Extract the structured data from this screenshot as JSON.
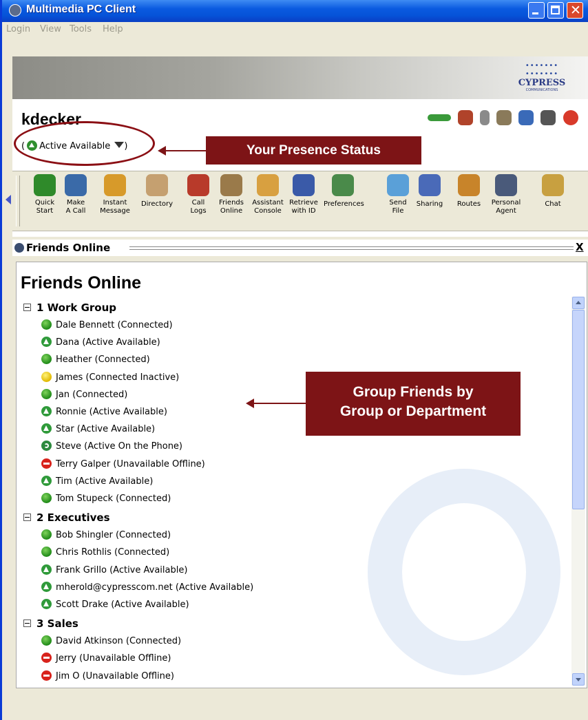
{
  "window": {
    "title": "Multimedia PC Client"
  },
  "menu": [
    "Login",
    "View",
    "Tools",
    "Help"
  ],
  "banner": {
    "logo_text": "CYPRESS",
    "logo_sub": "COMMUNICATIONS"
  },
  "user": {
    "name": "kdecker",
    "presence_prefix": "(",
    "presence": "Active Available",
    "presence_suffix": ")"
  },
  "annotations": {
    "presence_callout": "Your Presence Status",
    "group_callout_line1": "Group Friends by",
    "group_callout_line2": "Group or Department",
    "callout_color": "#7d1416"
  },
  "toolbar": [
    {
      "label": "Quick\nStart",
      "icon": "flag-icon",
      "color": "#2f8a2a"
    },
    {
      "label": "Make\nA Call",
      "icon": "phone-icon",
      "color": "#3a6aa8"
    },
    {
      "label": "Instant\nMessage",
      "icon": "person-icon",
      "color": "#d79a2a"
    },
    {
      "label": "Directory",
      "icon": "directory-icon",
      "color": "#c5a070"
    },
    {
      "label": "Call\nLogs",
      "icon": "call-logs-icon",
      "color": "#b83a2a"
    },
    {
      "label": "Friends\nOnline",
      "icon": "friends-icon",
      "color": "#9a7a4a"
    },
    {
      "label": "Assistant\nConsole",
      "icon": "console-icon",
      "color": "#d8a040"
    },
    {
      "label": "Retrieve\nwith ID",
      "icon": "retrieve-icon",
      "color": "#3a5aa8"
    },
    {
      "label": "Preferences",
      "icon": "preferences-icon",
      "color": "#4a8a4a"
    },
    {
      "label": "Send\nFile",
      "icon": "send-file-icon",
      "color": "#5aa0d8"
    },
    {
      "label": "Sharing",
      "icon": "sharing-icon",
      "color": "#4a6ab8"
    },
    {
      "label": "Routes",
      "icon": "routes-icon",
      "color": "#c8842a"
    },
    {
      "label": "Personal\nAgent",
      "icon": "agent-icon",
      "color": "#4a5a7a"
    },
    {
      "label": "Chat",
      "icon": "chat-icon",
      "color": "#c8a040"
    }
  ],
  "panel": {
    "header": "Friends Online",
    "close": "X",
    "title": "Friends Online"
  },
  "groups": [
    {
      "name": "1 Work Group",
      "friends": [
        {
          "text": "Dale Bennett (Connected)",
          "status": "connected"
        },
        {
          "text": "Dana (Active Available)",
          "status": "available"
        },
        {
          "text": "Heather (Connected)",
          "status": "connected"
        },
        {
          "text": "James (Connected Inactive)",
          "status": "inactive"
        },
        {
          "text": "Jan (Connected)",
          "status": "connected"
        },
        {
          "text": "Ronnie (Active Available)",
          "status": "available"
        },
        {
          "text": "Star (Active Available)",
          "status": "available"
        },
        {
          "text": "Steve (Active On the Phone)",
          "status": "phone"
        },
        {
          "text": "Terry Galper (Unavailable Offline)",
          "status": "offline"
        },
        {
          "text": "Tim (Active Available)",
          "status": "available"
        },
        {
          "text": "Tom Stupeck (Connected)",
          "status": "connected"
        }
      ]
    },
    {
      "name": "2 Executives",
      "friends": [
        {
          "text": "Bob Shingler (Connected)",
          "status": "connected"
        },
        {
          "text": "Chris Rothlis (Connected)",
          "status": "connected"
        },
        {
          "text": "Frank Grillo (Active Available)",
          "status": "available"
        },
        {
          "text": "mherold@cypresscom.net (Active Available)",
          "status": "available"
        },
        {
          "text": "Scott Drake (Active Available)",
          "status": "available"
        }
      ]
    },
    {
      "name": "3 Sales",
      "friends": [
        {
          "text": "David Atkinson (Connected)",
          "status": "connected"
        },
        {
          "text": "Jerry (Unavailable Offline)",
          "status": "offline"
        },
        {
          "text": "Jim O (Unavailable Offline)",
          "status": "offline"
        }
      ]
    }
  ]
}
